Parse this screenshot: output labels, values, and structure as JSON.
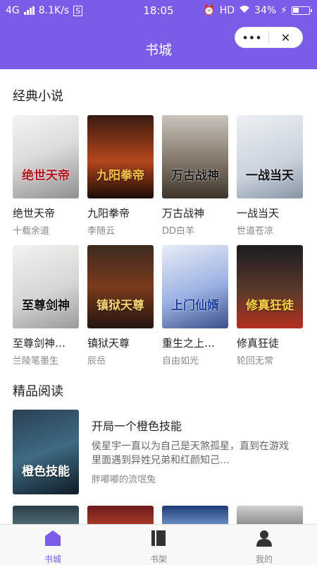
{
  "status_bar": {
    "network": "4G",
    "speed": "8.1K/s",
    "time": "18:05",
    "hd": "HD",
    "battery": "34%"
  },
  "nav": {
    "title": "书城",
    "more_label": "•••",
    "close_label": "✕"
  },
  "sections": {
    "classic_title": "经典小说",
    "featured_title": "精品阅读"
  },
  "books": [
    {
      "title": "绝世天帝",
      "author": "十载余道",
      "cover_text": "绝世天帝"
    },
    {
      "title": "九阳拳帝",
      "author": "李随云",
      "cover_text": "九阳拳帝"
    },
    {
      "title": "万古战神",
      "author": "DD白羊",
      "cover_text": "万古战神"
    },
    {
      "title": "一战当天",
      "author": "世道苍凉",
      "cover_text": "一战当天"
    },
    {
      "title": "至尊剑神…",
      "author": "兰陵笔墨生",
      "cover_text": "至尊剑神"
    },
    {
      "title": "镇狱天尊",
      "author": "辰岳",
      "cover_text": "镇狱天尊"
    },
    {
      "title": "重生之上…",
      "author": "自由如光",
      "cover_text": "上门仙婿"
    },
    {
      "title": "修真狂徒",
      "author": "轮回无常",
      "cover_text": "修真狂徒"
    }
  ],
  "featured": {
    "title": "开局一个橙色技能",
    "description": "侯星宇一直以为自己是天煞孤星，直到在游戏里面遇到异姓兄弟和红颜知己…",
    "author": "胖嘟嘟的流氓兔",
    "cover_text": "橙色技能"
  },
  "tabs": [
    {
      "label": "书城",
      "icon": "home-icon",
      "active": true
    },
    {
      "label": "书架",
      "icon": "bookshelf-icon",
      "active": false
    },
    {
      "label": "我的",
      "icon": "user-icon",
      "active": false
    }
  ],
  "colors": {
    "accent": "#7a5ce8",
    "text": "#222222",
    "muted": "#888888"
  }
}
